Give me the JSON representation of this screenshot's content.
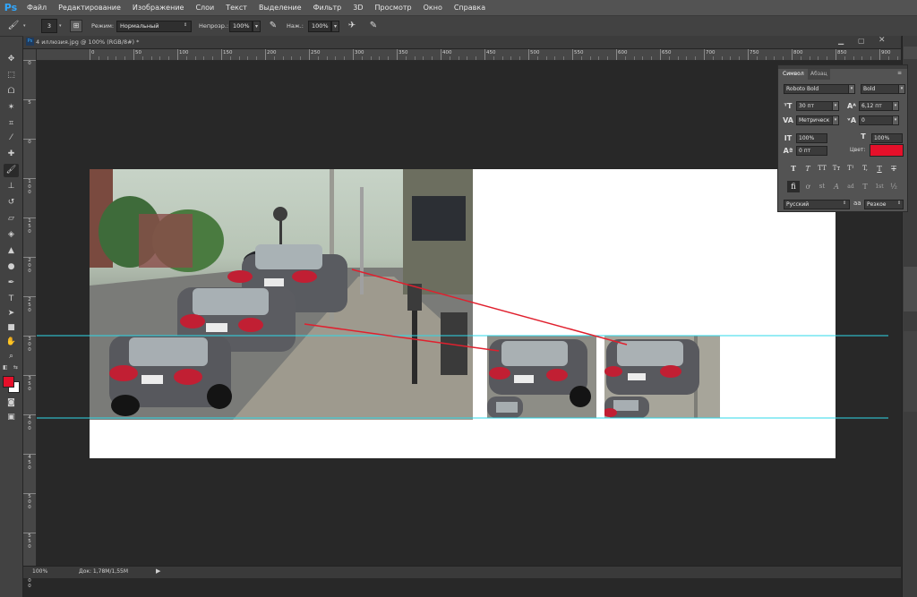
{
  "app": {
    "logo": "Ps"
  },
  "menu": [
    "Файл",
    "Редактирование",
    "Изображение",
    "Слои",
    "Текст",
    "Выделение",
    "Фильтр",
    "3D",
    "Просмотр",
    "Окно",
    "Справка"
  ],
  "options": {
    "brush_size": "3",
    "mode_label": "Режим:",
    "mode_value": "Нормальный",
    "opacity_label": "Непрозр.:",
    "opacity_value": "100%",
    "pressure_label": "Наж.:",
    "pressure_value": "100%"
  },
  "document": {
    "tab_title": "4 иллюзия.jpg @ 100% (RGB/8#) *"
  },
  "rulers": {
    "h": [
      "0",
      "50",
      "100",
      "150",
      "200",
      "250",
      "300",
      "350",
      "400",
      "450",
      "500",
      "550",
      "600",
      "650",
      "700",
      "750",
      "800",
      "850",
      "900",
      "950"
    ],
    "v": [
      "0",
      "5",
      "0",
      "1\n0\n0",
      "1\n5\n0",
      "2\n0\n0",
      "2\n5\n0",
      "3\n0\n0",
      "3\n5\n0",
      "4\n0\n0",
      "4\n5\n0",
      "5\n0\n0",
      "5\n5\n0",
      "6\n0\n0"
    ]
  },
  "status": {
    "zoom": "100%",
    "doc_info": "Док: 1,78M/1,55M"
  },
  "character_panel": {
    "tabs": [
      "Символ",
      "Абзац"
    ],
    "font_family": "Roboto Bold",
    "font_style": "Bold",
    "font_size": "30 пт",
    "leading": "6,12 пт",
    "kerning": "Метрическ",
    "tracking": "0",
    "vscale": "100%",
    "hscale": "100%",
    "baseline": "0 пт",
    "color_label": "Цвет:",
    "color_value": "#e5102a",
    "language": "Русский",
    "antialias_glyph": "aa",
    "antialias": "Резкое",
    "style_buttons": [
      "T",
      "T",
      "TT",
      "Tт",
      "T¹",
      "T,",
      "T",
      "T"
    ],
    "opentype_buttons": [
      "fi",
      "ơ",
      "st",
      "A",
      "ad",
      "T",
      "1st",
      "½"
    ]
  },
  "colors": {
    "foreground": "#e5102a",
    "background": "#ffffff",
    "guide": "#2fd8e8",
    "arrow": "#e0202e"
  }
}
